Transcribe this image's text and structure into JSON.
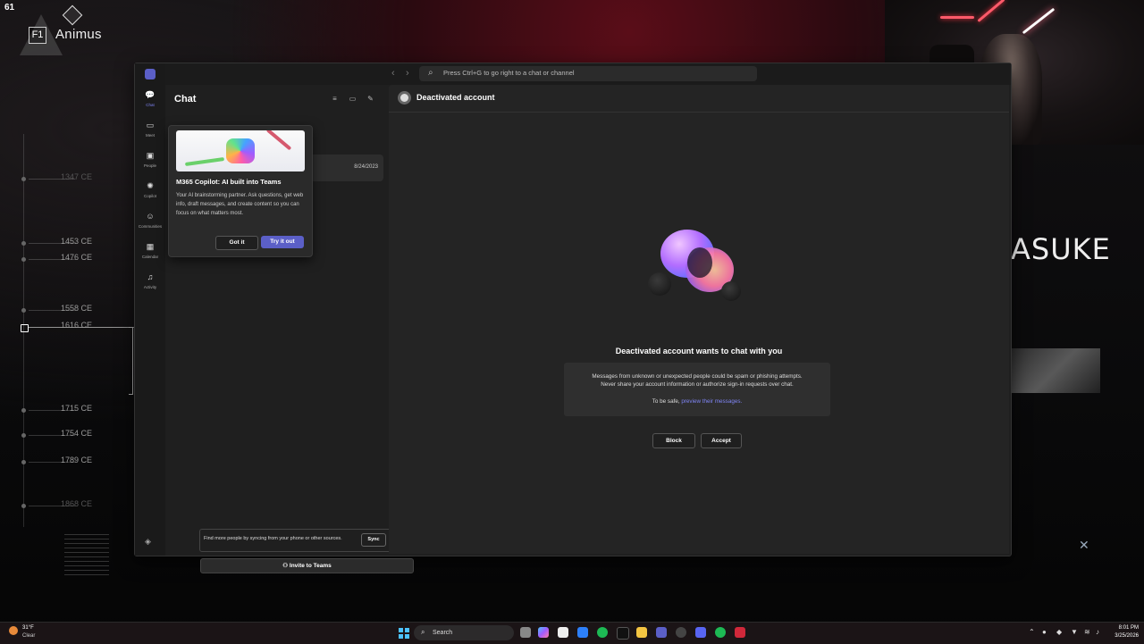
{
  "overlay": {
    "fps": "61",
    "logo_key": "F1",
    "logo_text": "Animus",
    "timeline": [
      {
        "label": "1347 CE",
        "state": "dim"
      },
      {
        "label": "1453 CE",
        "state": "normal"
      },
      {
        "label": "1476 CE",
        "state": "normal"
      },
      {
        "label": "1558 CE",
        "state": "normal"
      },
      {
        "label": "1616 CE",
        "state": "active"
      },
      {
        "label": "1715 CE",
        "state": "normal"
      },
      {
        "label": "1754 CE",
        "state": "normal"
      },
      {
        "label": "1789 CE",
        "state": "normal"
      },
      {
        "label": "1868 CE",
        "state": "dim"
      }
    ],
    "right_big_text": "ASUKE"
  },
  "search": {
    "placeholder": "Press Ctrl+G to go right to a chat or channel"
  },
  "rail": {
    "items": [
      {
        "label": "Chat",
        "icon": "chat-icon",
        "glyph": "💬"
      },
      {
        "label": "Meet",
        "icon": "video-icon",
        "glyph": "▭"
      },
      {
        "label": "People",
        "icon": "people-icon",
        "glyph": "▣"
      },
      {
        "label": "Copilot",
        "icon": "copilot-icon",
        "glyph": "✺"
      },
      {
        "label": "Communities",
        "icon": "communities-icon",
        "glyph": "☺"
      },
      {
        "label": "Calendar",
        "icon": "calendar-icon",
        "glyph": "▦"
      },
      {
        "label": "Activity",
        "icon": "bell-icon",
        "glyph": "♫"
      }
    ]
  },
  "chat_pane": {
    "title": "Chat",
    "row_date": "8/24/2023",
    "sync_text": "Find more people by syncing from your phone or other sources.",
    "sync_button": "Sync",
    "invite_button": "Invite to Teams"
  },
  "popup": {
    "title": "M365 Copilot: AI built into Teams",
    "body": "Your AI brainstorming partner. Ask questions, get web info, draft messages, and create content so you can focus on what matters most.",
    "got_it": "Got it",
    "try_it": "Try it out"
  },
  "main": {
    "header_name": "Deactivated account",
    "request_title": "Deactivated account wants to chat with you",
    "warning_line1": "Messages from unknown or unexpected people could be spam or phishing attempts.",
    "warning_line2": "Never share your account information or authorize sign-in requests over chat.",
    "safe_prefix": "To be safe,",
    "safe_link": "preview their messages.",
    "block": "Block",
    "accept": "Accept"
  },
  "taskbar": {
    "weather_temp": "31°F",
    "weather_cond": "Clear",
    "search": "Search",
    "time": "8:01 PM",
    "date": "3/25/2026"
  },
  "colors": {
    "accent": "#5b5fc7",
    "link": "#7f85f5"
  }
}
